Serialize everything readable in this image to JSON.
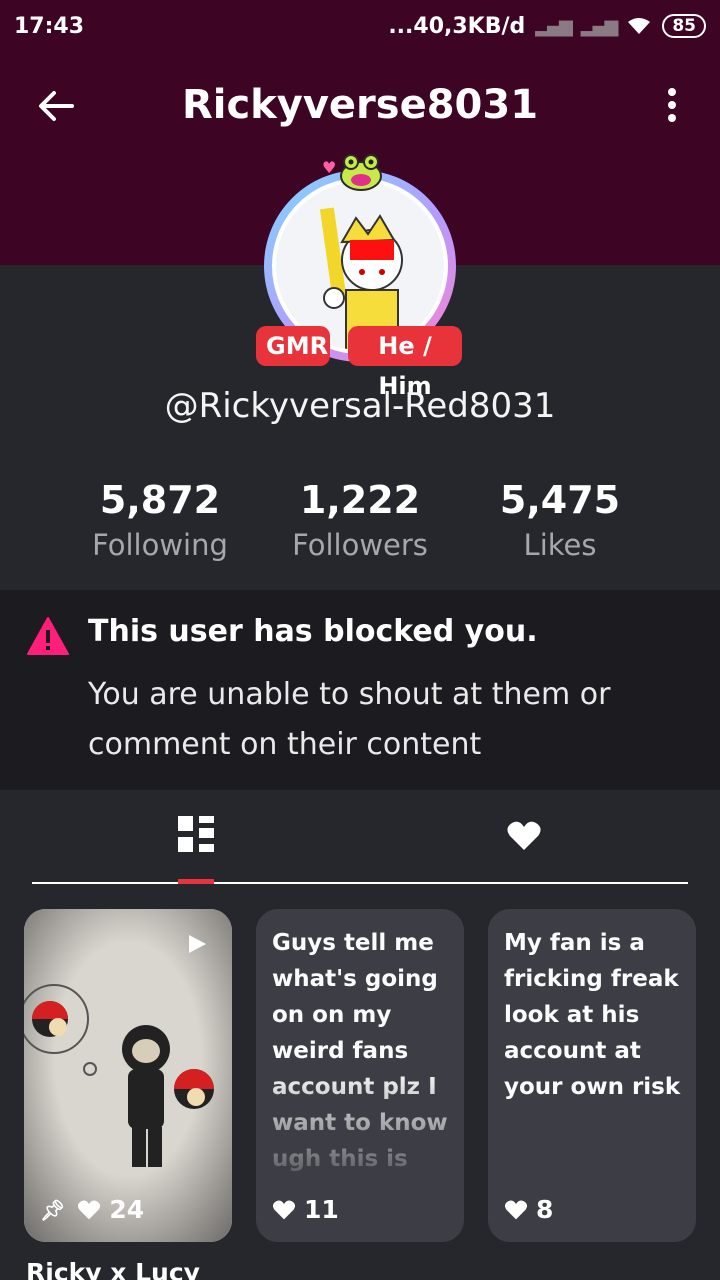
{
  "status": {
    "time": "17:43",
    "network": "...40,3KB/d",
    "battery": "85"
  },
  "header": {
    "title": "Rickyverse8031"
  },
  "profile": {
    "tags": [
      "GMR",
      "He / Him"
    ],
    "handle": "@Rickyversal-Red8031"
  },
  "stats": [
    {
      "value": "5,872",
      "label": "Following"
    },
    {
      "value": "1,222",
      "label": "Followers"
    },
    {
      "value": "5,475",
      "label": "Likes"
    }
  ],
  "blocked": {
    "title": "This user has blocked you.",
    "text": "You are unable to shout at them or comment on their content"
  },
  "tabs": [
    {
      "icon": "grid-icon",
      "active": true
    },
    {
      "icon": "heart-icon",
      "active": false
    }
  ],
  "posts": [
    {
      "type": "video",
      "likes": "24",
      "pinned": true,
      "caption": "Ricky x Lucy"
    },
    {
      "type": "text",
      "text": "Guys tell me what's going on on my weird fans account plz I want to know ugh this is",
      "likes": "11"
    },
    {
      "type": "text",
      "text": "My fan is a fricking freak look at his account at your own risk",
      "likes": "8"
    }
  ],
  "colors": {
    "header_bg": "#3d0424",
    "accent_red": "#e8333b",
    "body_bg": "#26272d",
    "warning_pink": "#ff1f7a"
  }
}
